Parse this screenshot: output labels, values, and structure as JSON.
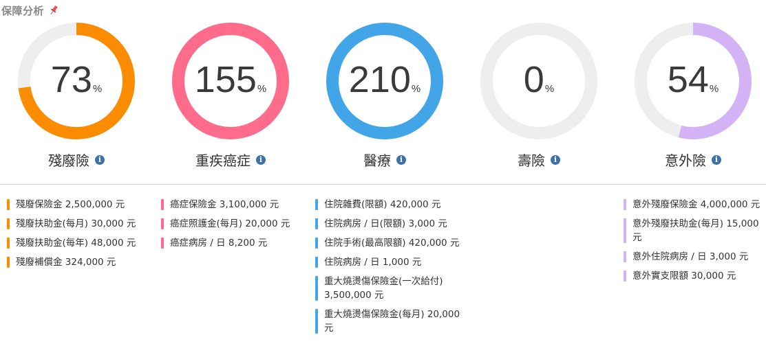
{
  "header": {
    "title": "保障分析",
    "pin_icon": "pin-icon",
    "pin_color": "#e5534b"
  },
  "gauges": [
    {
      "key": "disability",
      "value": "73",
      "unit": "%",
      "percent": 73,
      "label": "殘廢險",
      "color": "#fb8c00"
    },
    {
      "key": "cancer",
      "value": "155",
      "unit": "%",
      "percent": 155,
      "label": "重疾癌症",
      "color": "#ff6b8a"
    },
    {
      "key": "medical",
      "value": "210",
      "unit": "%",
      "percent": 210,
      "label": "醫療",
      "color": "#42a5e8"
    },
    {
      "key": "life",
      "value": "0",
      "unit": "%",
      "percent": 0,
      "label": "壽險",
      "color": "#9e9e9e"
    },
    {
      "key": "accident",
      "value": "54",
      "unit": "%",
      "percent": 54,
      "label": "意外險",
      "color": "#d3b2f6"
    }
  ],
  "ring_track_color": "#eeeeee",
  "info_icon": {
    "name": "info-icon",
    "glyph": "i",
    "color": "#3c72a8"
  },
  "details": [
    {
      "key": "disability",
      "color": "#fb8c00",
      "items": [
        "殘廢保險金 2,500,000 元",
        "殘廢扶助金(每月) 30,000 元",
        "殘廢扶助金(每年) 48,000 元",
        "殘廢補償金 324,000 元"
      ]
    },
    {
      "key": "cancer",
      "color": "#ff6b8a",
      "items": [
        "癌症保險金 3,100,000 元",
        "癌症照護金(每月) 20,000 元",
        "癌症病房 / 日 8,200 元"
      ]
    },
    {
      "key": "medical",
      "color": "#42a5e8",
      "items": [
        "住院雜費(限額) 420,000 元",
        "住院病房 / 日(限額) 3,000 元",
        "住院手術(最高限額) 420,000 元",
        "住院病房 / 日 1,000 元",
        "重大燒燙傷保險金(一次給付)\n3,500,000 元",
        "重大燒燙傷保險金(每月) 20,000\n元"
      ]
    },
    {
      "key": "life",
      "color": "#9e9e9e",
      "items": []
    },
    {
      "key": "accident",
      "color": "#d3b2f6",
      "items": [
        "意外殘廢保險金 4,000,000 元",
        "意外殘廢扶助金(每月) 15,000\n元",
        "意外住院病房 / 日 3,000 元",
        "意外實支限額 30,000 元"
      ]
    }
  ]
}
